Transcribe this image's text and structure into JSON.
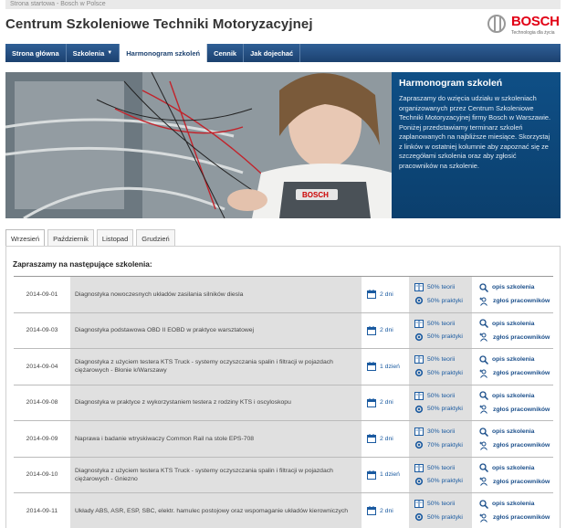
{
  "breadcrumb": "Strona startowa - Bosch w Polsce",
  "page_title": "Centrum Szkoleniowe Techniki Motoryzacyjnej",
  "logo": {
    "word": "BOSCH",
    "tagline": "Technologia dla życia",
    "icon": "bosch-armature-icon"
  },
  "nav": [
    {
      "label": "Strona główna"
    },
    {
      "label": "Szkolenia"
    },
    {
      "label": "Harmonogram szkoleń"
    },
    {
      "label": "Cennik"
    },
    {
      "label": "Jak dojechać"
    }
  ],
  "hero": {
    "title": "Harmonogram szkoleń",
    "text": "Zapraszamy do wzięcia udziału w szkoleniach organizowanych przez Centrum Szkoleniowe Techniki Motoryzacyjnej firmy Bosch w Warszawie. Poniżej przedstawiamy terminarz szkoleń zaplanowanych na najbliższe miesiące. Skorzystaj z linków w ostatniej kolumnie aby zapoznać się ze szczegółami szkolenia oraz aby zgłosić pracowników na szkolenie."
  },
  "tabs": [
    {
      "label": "Wrzesień"
    },
    {
      "label": "Październik"
    },
    {
      "label": "Listopad"
    },
    {
      "label": "Grudzień"
    }
  ],
  "intro": "Zapraszamy na następujące szkolenia:",
  "trainings": [
    {
      "date": "2014-09-01",
      "title": "Diagnostyka nowoczesnych układów zasilania silników diesla",
      "days": "2 dni",
      "theory": "50% teorii",
      "practice": "50% praktyki",
      "details": "opis szkolenia",
      "register": "zgłoś pracowników"
    },
    {
      "date": "2014-09-03",
      "title": "Diagnostyka podstawowa OBD II EOBD w praktyce warsztatowej",
      "days": "2 dni",
      "theory": "50% teorii",
      "practice": "50% praktyki",
      "details": "opis szkolenia",
      "register": "zgłoś pracowników"
    },
    {
      "date": "2014-09-04",
      "title": "Diagnostyka z użyciem testera KTS Truck - systemy oczyszczania spalin i filtracji w pojazdach ciężarowych - Błonie k/Warszawy",
      "days": "1 dzień",
      "theory": "50% teorii",
      "practice": "50% praktyki",
      "details": "opis szkolenia",
      "register": "zgłoś pracowników"
    },
    {
      "date": "2014-09-08",
      "title": "Diagnostyka w praktyce z wykorzystaniem testera z rodziny KTS i oscyloskopu",
      "days": "2 dni",
      "theory": "50% teorii",
      "practice": "50% praktyki",
      "details": "opis szkolenia",
      "register": "zgłoś pracowników"
    },
    {
      "date": "2014-09-09",
      "title": "Naprawa i badanie wtryskiwaczy Common Rail na stole EPS-708",
      "days": "2 dni",
      "theory": "30% teorii",
      "practice": "70% praktyki",
      "details": "opis szkolenia",
      "register": "zgłoś pracowników"
    },
    {
      "date": "2014-09-10",
      "title": "Diagnostyka z użyciem testera KTS Truck - systemy oczyszczania spalin i filtracji w pojazdach ciężarowych - Gniezno",
      "days": "1 dzień",
      "theory": "50% teorii",
      "practice": "50% praktyki",
      "details": "opis szkolenia",
      "register": "zgłoś pracowników"
    },
    {
      "date": "2014-09-11",
      "title": "Układy ABS, ASR, ESP, SBC, elektr. hamulec postojowy oraz wspomaganie układów kierowniczych",
      "days": "2 dni",
      "theory": "50% teorii",
      "practice": "50% praktyki",
      "details": "opis szkolenia",
      "register": "zgłoś pracowników"
    }
  ],
  "icons": {
    "days": "calendar-icon",
    "split": "book-icon",
    "details": "magnifier-icon",
    "register": "add-person-icon"
  },
  "colors": {
    "brand_red": "#e20015",
    "nav_blue": "#1c416f",
    "link_blue": "#1a5aa0",
    "panel_blue": "#0b3f6d"
  }
}
